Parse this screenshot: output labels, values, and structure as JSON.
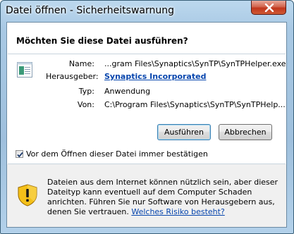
{
  "window": {
    "title": "Datei öffnen - Sicherheitswarnung"
  },
  "dialog": {
    "question": "Möchten Sie diese Datei ausführen?",
    "file_icon": "application-window-icon",
    "details": [
      {
        "label": "Name:",
        "value": "...gram Files\\Synaptics\\SynTP\\SynTPHelper.exe"
      },
      {
        "label": "Herausgeber:",
        "value": "Synaptics Incorporated"
      },
      {
        "label": "Typ:",
        "value": "Anwendung"
      },
      {
        "label": "Von:",
        "value": "C:\\Program Files\\Synaptics\\SynTP\\SynTPHelp..."
      }
    ],
    "run_label": "Ausführen",
    "cancel_label": "Abbrechen",
    "checkbox_label": "Vor dem Öffnen dieser Datei immer bestätigen",
    "checkbox_checked": true
  },
  "warning": {
    "icon": "security-shield-warning-icon",
    "text": "Dateien aus dem Internet können nützlich sein, aber dieser Dateityp kann eventuell auf dem Computer Schaden anrichten. Führen Sie nur Software von Herausgebern aus, denen Sie vertrauen.",
    "link": "Welches Risiko besteht?"
  },
  "colors": {
    "link": "#0645ad",
    "close_button": "#c1361c",
    "shield": "#f4c019"
  }
}
